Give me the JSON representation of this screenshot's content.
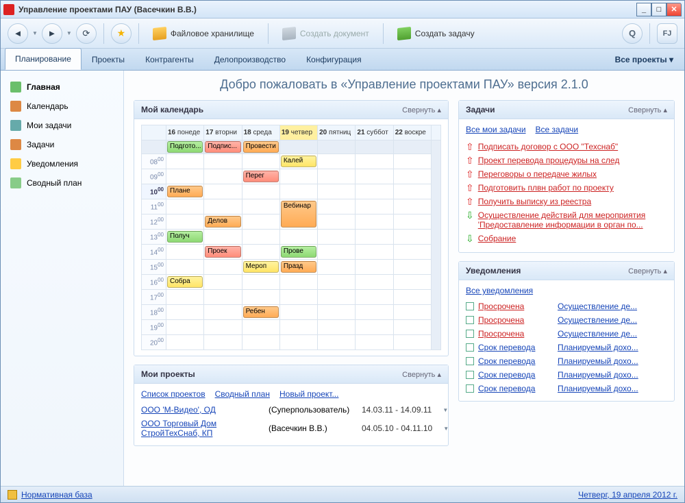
{
  "window_title": "Управление проектами ПАУ (Васечкин В.В.)",
  "toolbar": {
    "file_storage": "Файловое хранилище",
    "create_document": "Создать документ",
    "create_task": "Создать задачу"
  },
  "tabs": {
    "planning": "Планирование",
    "projects": "Проекты",
    "contractors": "Контрагенты",
    "docflow": "Делопроизводство",
    "config": "Конфигурация",
    "all_projects": "Все проекты ▾"
  },
  "sidebar": [
    {
      "label": "Главная",
      "color": "#6bbf6b"
    },
    {
      "label": "Календарь",
      "color": "#d84"
    },
    {
      "label": "Мои задачи",
      "color": "#6aa"
    },
    {
      "label": "Задачи",
      "color": "#d84"
    },
    {
      "label": "Уведомления",
      "color": "#fc4"
    },
    {
      "label": "Сводный план",
      "color": "#8c8"
    }
  ],
  "welcome": "Добро пожаловать в «Управление проектами ПАУ» версия 2.1.0",
  "calendar": {
    "title": "Мой календарь",
    "collapse": "Свернуть ▴",
    "days": [
      {
        "num": "16",
        "name": "понеде"
      },
      {
        "num": "17",
        "name": "вторни"
      },
      {
        "num": "18",
        "name": "среда"
      },
      {
        "num": "19",
        "name": "четвер",
        "hl": true
      },
      {
        "num": "20",
        "name": "пятниц"
      },
      {
        "num": "21",
        "name": "суббот"
      },
      {
        "num": "22",
        "name": "воскре"
      }
    ],
    "allday": [
      {
        "col": 0,
        "label": "Подгото...",
        "cls": "ev-green"
      },
      {
        "col": 1,
        "label": "Подпис...",
        "cls": "ev-red"
      },
      {
        "col": 2,
        "label": "Провести",
        "cls": "ev-orange"
      }
    ],
    "times": [
      "08",
      "09",
      "10",
      "11",
      "12",
      "13",
      "14",
      "15",
      "16",
      "17",
      "18",
      "19",
      "20"
    ],
    "events": [
      {
        "time": "08",
        "col": 3,
        "label": "Калей",
        "cls": "ev-yellow"
      },
      {
        "time": "09",
        "col": 2,
        "label": "Перег",
        "cls": "ev-red"
      },
      {
        "time": "10",
        "col": 0,
        "label": "Плане",
        "cls": "ev-orange"
      },
      {
        "time": "11",
        "col": 3,
        "label": "Вебинар",
        "cls": "ev-orange",
        "rows": 2
      },
      {
        "time": "12",
        "col": 1,
        "label": "Делов",
        "cls": "ev-orange"
      },
      {
        "time": "13",
        "col": 0,
        "label": "Получ",
        "cls": "ev-green"
      },
      {
        "time": "14",
        "col": 1,
        "label": "Проек",
        "cls": "ev-red"
      },
      {
        "time": "14",
        "col": 3,
        "label": "Прове",
        "cls": "ev-green"
      },
      {
        "time": "15",
        "col": 2,
        "label": "Мероп",
        "cls": "ev-yellow"
      },
      {
        "time": "15",
        "col": 3,
        "label": "Празд",
        "cls": "ev-orange"
      },
      {
        "time": "16",
        "col": 0,
        "label": "Собра",
        "cls": "ev-yellow"
      },
      {
        "time": "18",
        "col": 2,
        "label": "Ребен",
        "cls": "ev-orange"
      }
    ]
  },
  "projects": {
    "title": "Мои проекты",
    "collapse": "Свернуть ▴",
    "links": {
      "list": "Список проектов",
      "plan": "Сводный план",
      "new": "Новый проект..."
    },
    "items": [
      {
        "name": "ООО 'М-Видео', ОД",
        "user": "(Суперпользователь)",
        "dates": "14.03.11 - 14.09.11"
      },
      {
        "name": "ООО Торговый Дом СтройТехСнаб, КП",
        "user": "(Васечкин В.В.)",
        "dates": "04.05.10 - 04.11.10"
      }
    ]
  },
  "tasks": {
    "title": "Задачи",
    "collapse": "Свернуть ▴",
    "links": {
      "my": "Все мои задачи",
      "all": "Все задачи"
    },
    "items": [
      {
        "dir": "up",
        "text": "Подписать договор с ООО \"Техснаб\""
      },
      {
        "dir": "up",
        "text": "Проект перевода процедуры на след"
      },
      {
        "dir": "up",
        "text": "Переговоры о передаче жилых"
      },
      {
        "dir": "up",
        "text": "Подготовить плвн работ по проекту"
      },
      {
        "dir": "up",
        "text": "Получить выписку из реестра"
      },
      {
        "dir": "down",
        "text": "Осуществление действий для мероприятия 'Предоставление информации в орган по...",
        "green": true
      },
      {
        "dir": "down",
        "text": "Собрание",
        "green": true
      }
    ]
  },
  "notifs": {
    "title": "Уведомления",
    "collapse": "Свернуть ▴",
    "link_all": "Все уведомления",
    "items": [
      {
        "status": "Просрочена",
        "red": true,
        "link": "Осуществление де..."
      },
      {
        "status": "Просрочена",
        "red": true,
        "link": "Осуществление де..."
      },
      {
        "status": "Просрочена",
        "red": true,
        "link": "Осуществление де..."
      },
      {
        "status": "Срок перевода",
        "red": false,
        "link": "Планируемый дохо..."
      },
      {
        "status": "Срок перевода",
        "red": false,
        "link": "Планируемый дохо..."
      },
      {
        "status": "Срок перевода",
        "red": false,
        "link": "Планируемый дохо..."
      },
      {
        "status": "Срок перевода",
        "red": false,
        "link": "Планируемый дохо..."
      }
    ]
  },
  "statusbar": {
    "normative": "Нормативная база",
    "date": "Четверг, 19 апреля 2012 г."
  }
}
